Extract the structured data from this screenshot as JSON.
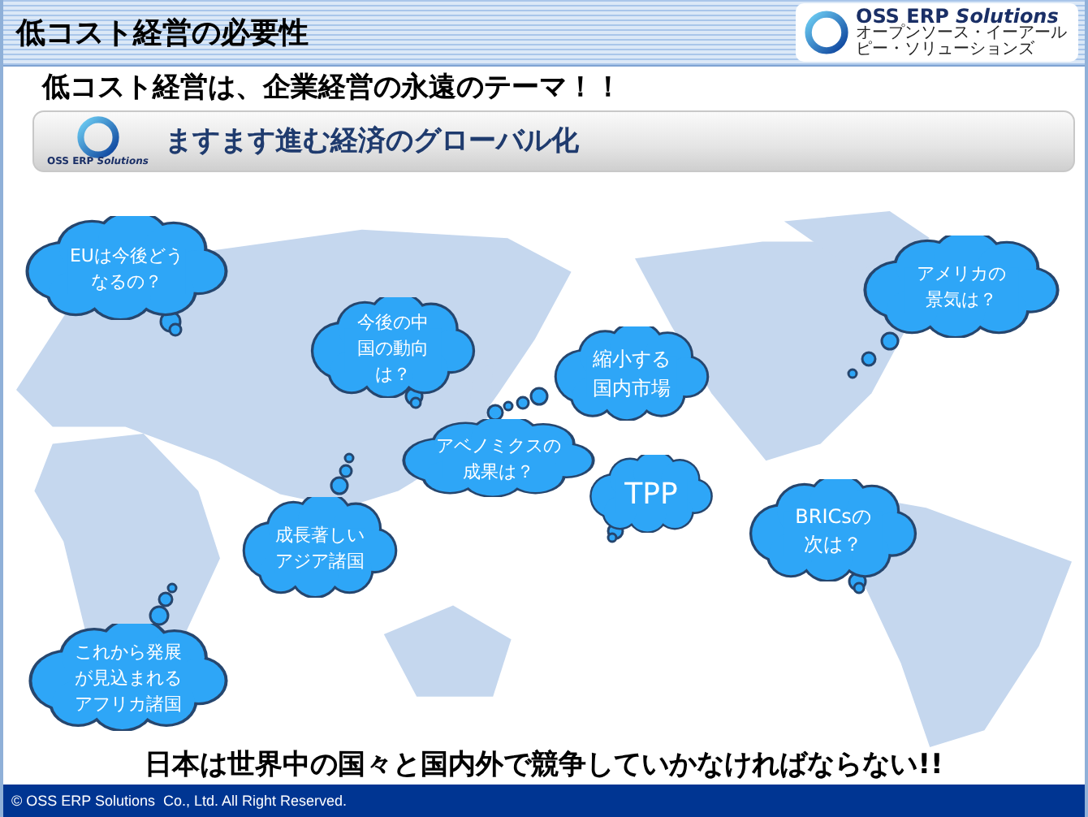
{
  "header": {
    "title": "低コスト経営の必要性",
    "logo": {
      "text": "OSS ERP *Solutions*",
      "subtitle": "オープンソース・イーアールピー・ソリューションズ"
    }
  },
  "headline": "低コスト経営は、企業経営の永遠のテーマ！！",
  "banner": {
    "logo_text": "OSS ERP *Solutions*",
    "title": "ますます進む経済のグローバル化"
  },
  "clouds": [
    {
      "text": "EUは今後どうなるの？"
    },
    {
      "text": "今後の中国の動向は？"
    },
    {
      "text": "縮小する国内市場"
    },
    {
      "text": "アベノミクスの成果は？"
    },
    {
      "text": "TPP"
    },
    {
      "text": "アメリカの景気は？"
    },
    {
      "text": "BRICsの次は？"
    },
    {
      "text": "成長著しいアジア諸国"
    },
    {
      "text": "これから発展が見込まれるアフリカ諸国"
    }
  ],
  "conclusion": "日本は世界中の国々と国内外で競争していかなければならない!!",
  "footer": "© OSS ERP Solutions  Co., Ltd. All Right Reserved."
}
